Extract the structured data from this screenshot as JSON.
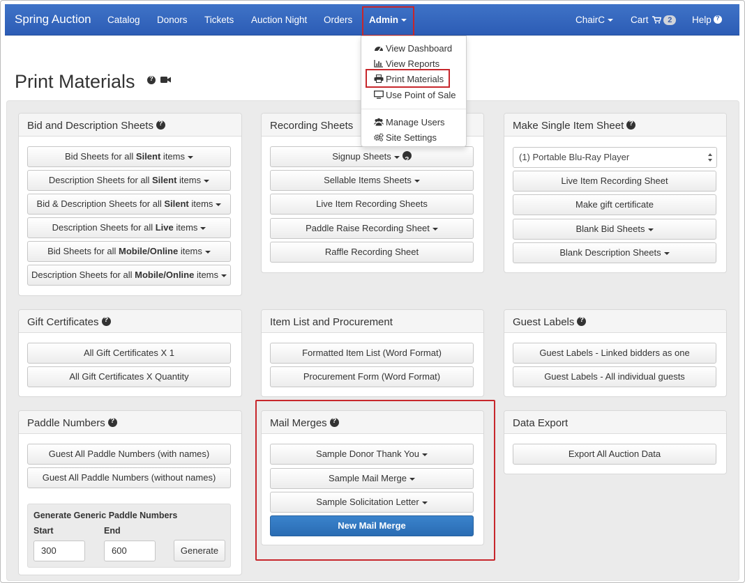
{
  "navbar": {
    "brand": "Spring Auction",
    "items": [
      "Catalog",
      "Donors",
      "Tickets",
      "Auction Night",
      "Orders"
    ],
    "admin": "Admin",
    "user": "ChairC",
    "cart_label": "Cart",
    "cart_count": "2",
    "help_label": "Help"
  },
  "admin_menu": {
    "items": [
      "View Dashboard",
      "View Reports",
      "Print Materials",
      "Use Point of Sale",
      "Manage Users",
      "Site Settings"
    ]
  },
  "page": {
    "title": "Print Materials"
  },
  "panels": {
    "bid_desc": {
      "title": "Bid and Description Sheets",
      "buttons": [
        {
          "pre": "Bid Sheets for all ",
          "bold": "Silent",
          "post": " items"
        },
        {
          "pre": "Description Sheets for all ",
          "bold": "Silent",
          "post": " items"
        },
        {
          "pre": "Bid & Description Sheets for all ",
          "bold": "Silent",
          "post": " items"
        },
        {
          "pre": "Description Sheets for all ",
          "bold": "Live",
          "post": " items"
        },
        {
          "pre": "Bid Sheets for all ",
          "bold": "Mobile/Online",
          "post": " items"
        },
        {
          "pre": "Description Sheets for all ",
          "bold": "Mobile/Online",
          "post": " items"
        }
      ]
    },
    "recording": {
      "title": "Recording Sheets",
      "buttons": [
        "Signup Sheets",
        "Sellable Items Sheets",
        "Live Item Recording Sheets",
        "Paddle Raise Recording Sheet",
        "Raffle Recording Sheet"
      ]
    },
    "single_item": {
      "title": "Make Single Item Sheet",
      "select_value": "(1) Portable Blu-Ray Player",
      "buttons": [
        "Live Item Recording Sheet",
        "Make gift certificate",
        "Blank Bid Sheets",
        "Blank Description Sheets"
      ]
    },
    "gift": {
      "title": "Gift Certificates",
      "buttons": [
        "All Gift Certificates X 1",
        "All Gift Certificates X Quantity"
      ]
    },
    "item_list": {
      "title": "Item List and Procurement",
      "buttons": [
        "Formatted Item List (Word Format)",
        "Procurement Form (Word Format)"
      ]
    },
    "guest_labels": {
      "title": "Guest Labels",
      "buttons": [
        "Guest Labels - Linked bidders as one",
        "Guest Labels - All individual guests"
      ]
    },
    "paddle": {
      "title": "Paddle Numbers",
      "buttons": [
        "Guest All Paddle Numbers (with names)",
        "Guest All Paddle Numbers (without names)"
      ],
      "generate": {
        "title": "Generate Generic Paddle Numbers",
        "start_label": "Start",
        "end_label": "End",
        "start_value": "300",
        "end_value": "600",
        "button": "Generate"
      }
    },
    "mail_merges": {
      "title": "Mail Merges",
      "buttons": [
        "Sample Donor Thank You",
        "Sample Mail Merge",
        "Sample Solicitation Letter"
      ],
      "primary": "New Mail Merge"
    },
    "export": {
      "title": "Data Export",
      "buttons": [
        "Export All Auction Data"
      ]
    }
  }
}
